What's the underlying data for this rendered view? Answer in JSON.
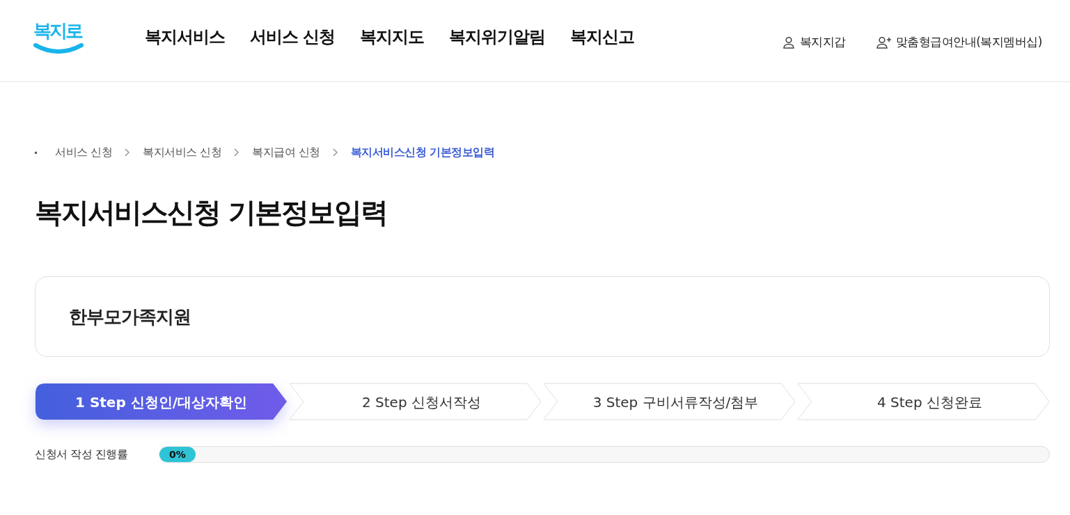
{
  "logo": "복지로",
  "nav": [
    "복지서비스",
    "서비스 신청",
    "복지지도",
    "복지위기알림",
    "복지신고"
  ],
  "user_links": [
    {
      "kind": "user",
      "label": "복지지갑"
    },
    {
      "kind": "user_add",
      "label": "맞춤형급여안내(복지멤버십)"
    }
  ],
  "breadcrumb": [
    {
      "label": "서비스 신청",
      "selected": false
    },
    {
      "label": "복지서비스 신청",
      "selected": false
    },
    {
      "label": "복지급여 신청",
      "selected": false
    },
    {
      "label": "복지서비스신청 기본정보입력",
      "selected": true
    }
  ],
  "title": "복지서비스신청 기본정보입력",
  "service_name": "한부모가족지원",
  "steps": [
    {
      "label": "1 Step 신청인/대상자확인",
      "selected": true
    },
    {
      "label": "2 Step 신청서작성",
      "selected": false
    },
    {
      "label": "3 Step 구비서류작성/첨부",
      "selected": false
    },
    {
      "label": "4 Step 신청완료",
      "selected": false
    }
  ],
  "progress": {
    "label": "신청서 작성 진행률",
    "level": 0,
    "reading": "0%"
  }
}
